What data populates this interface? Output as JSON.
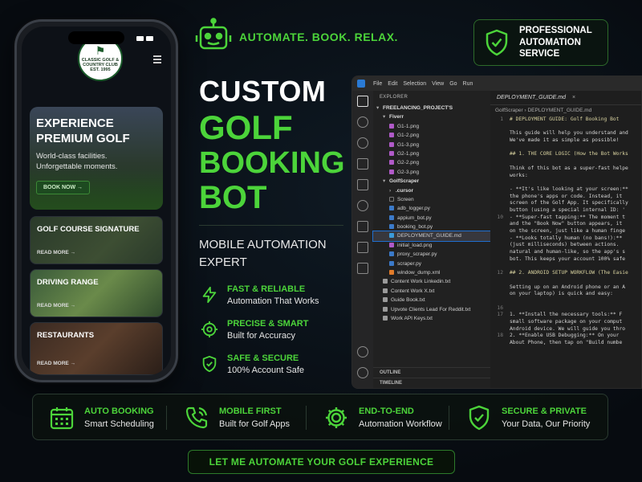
{
  "phone": {
    "status_time": "",
    "club_logo_text": "CLASSIC GOLF & COUNTRY CLUB",
    "club_logo_est": "EST. 1995",
    "hero_title_line1": "EXPERIENCE",
    "hero_title_line2": "PREMIUM GOLF",
    "hero_sub_line1": "World-class facilities.",
    "hero_sub_line2": "Unforgettable moments.",
    "book_button": "BOOK NOW →",
    "cards": [
      {
        "title": "GOLF COURSE SIGNATURE",
        "more": "READ MORE →"
      },
      {
        "title": "DRIVING RANGE",
        "more": "READ MORE →"
      },
      {
        "title": "RESTAURANTS",
        "more": "READ MORE →"
      }
    ]
  },
  "tagline": "AUTOMATE. BOOK. RELAX.",
  "headline": {
    "line1": "CUSTOM",
    "line2": "GOLF",
    "line3": "BOOKING",
    "line4": "BOT"
  },
  "subtitle": {
    "line1": "MOBILE AUTOMATION",
    "line2": "EXPERT"
  },
  "features": [
    {
      "title": "FAST & RELIABLE",
      "sub": "Automation That Works",
      "icon": "lightning-icon"
    },
    {
      "title": "PRECISE & SMART",
      "sub": "Built for Accuracy",
      "icon": "target-icon"
    },
    {
      "title": "SAFE & SECURE",
      "sub": "100% Account Safe",
      "icon": "shield-icon"
    }
  ],
  "pro_badge": {
    "line1": "PROFESSIONAL",
    "line2": "AUTOMATION",
    "line3": "SERVICE"
  },
  "vscode": {
    "menu": [
      "File",
      "Edit",
      "Selection",
      "View",
      "Go",
      "Run"
    ],
    "explorer_title": "EXPLORER",
    "project": "FREELANCING_PROJECT'S",
    "tree": [
      {
        "name": "Fiverr",
        "type": "folder",
        "depth": 1,
        "open": true
      },
      {
        "name": "G1-1.png",
        "type": "png",
        "depth": 2
      },
      {
        "name": "G1-2.png",
        "type": "png",
        "depth": 2
      },
      {
        "name": "G1-3.png",
        "type": "png",
        "depth": 2
      },
      {
        "name": "G2-1.png",
        "type": "png",
        "depth": 2
      },
      {
        "name": "G2-2.png",
        "type": "png",
        "depth": 2
      },
      {
        "name": "G2-3.png",
        "type": "png",
        "depth": 2
      },
      {
        "name": "GolfScraper",
        "type": "folder",
        "depth": 1,
        "open": true
      },
      {
        "name": ".cursor",
        "type": "folder",
        "depth": 2,
        "open": false
      },
      {
        "name": "Screen",
        "type": "none",
        "depth": 2
      },
      {
        "name": "adb_logger.py",
        "type": "py",
        "depth": 2
      },
      {
        "name": "appium_bot.py",
        "type": "py",
        "depth": 2
      },
      {
        "name": "booking_bot.py",
        "type": "py",
        "depth": 2
      },
      {
        "name": "DEPLOYMENT_GUIDE.md",
        "type": "md",
        "depth": 2,
        "selected": true
      },
      {
        "name": "initial_load.png",
        "type": "png",
        "depth": 2
      },
      {
        "name": "proxy_scraper.py",
        "type": "py",
        "depth": 2
      },
      {
        "name": "scraper.py",
        "type": "py",
        "depth": 2
      },
      {
        "name": "window_dump.xml",
        "type": "xml",
        "depth": 2
      },
      {
        "name": "Content Work Linkedin.txt",
        "type": "txt",
        "depth": 1
      },
      {
        "name": "Content Work X.txt",
        "type": "txt",
        "depth": 1
      },
      {
        "name": "Guide Book.txt",
        "type": "txt",
        "depth": 1
      },
      {
        "name": "Upvote Clients Lead For Reddit.txt",
        "type": "txt",
        "depth": 1
      },
      {
        "name": "Work API Keys.txt",
        "type": "txt",
        "depth": 1
      }
    ],
    "outline": "OUTLINE",
    "timeline": "TIMELINE",
    "tab": "DEPLOYMENT_GUIDE.md",
    "breadcrumb": "GolfScraper › DEPLOYMENT_GUIDE.md",
    "code": [
      {
        "n": "1",
        "t": "# DEPLOYMENT GUIDE: Golf Booking Bot",
        "h": true
      },
      {
        "n": "",
        "t": ""
      },
      {
        "n": "",
        "t": "This guide will help you understand and"
      },
      {
        "n": "",
        "t": "We've made it as simple as possible!"
      },
      {
        "n": "",
        "t": ""
      },
      {
        "n": "",
        "t": "## 1. THE CORE LOGIC (How the Bot Works",
        "h": true
      },
      {
        "n": "",
        "t": ""
      },
      {
        "n": "",
        "t": "Think of this bot as a super-fast helpe"
      },
      {
        "n": "",
        "t": "works:"
      },
      {
        "n": "",
        "t": ""
      },
      {
        "n": "",
        "t": "- **It's like looking at your screen:**"
      },
      {
        "n": "",
        "t": "the phone's apps or code. Instead, it"
      },
      {
        "n": "",
        "t": "screen of the Golf App. It specifically"
      },
      {
        "n": "",
        "t": "button (using a special internal ID: '"
      },
      {
        "n": "10",
        "t": "- **Super-fast tapping:** The moment t"
      },
      {
        "n": "",
        "t": "and the \"Book Now\" button appears, it"
      },
      {
        "n": "",
        "t": "on the screen, just like a human finge"
      },
      {
        "n": "",
        "t": "- **Looks totally human (no bans!):**"
      },
      {
        "n": "",
        "t": "(just milliseconds) between actions."
      },
      {
        "n": "",
        "t": "natural and human-like, so the app's s"
      },
      {
        "n": "",
        "t": "bot. This keeps your account 100% safe"
      },
      {
        "n": "",
        "t": ""
      },
      {
        "n": "12",
        "t": "## 2. ANDROID SETUP WORKFLOW (The Easie",
        "h": true
      },
      {
        "n": "",
        "t": ""
      },
      {
        "n": "",
        "t": "Setting up on an Android phone or an A"
      },
      {
        "n": "",
        "t": "on your laptop) is quick and easy:"
      },
      {
        "n": "",
        "t": ""
      },
      {
        "n": "16",
        "t": ""
      },
      {
        "n": "17",
        "t": "1. **Install the necessary tools:** F"
      },
      {
        "n": "",
        "t": "small software package on your comput"
      },
      {
        "n": "",
        "t": "Android device. We will guide you thro"
      },
      {
        "n": "18",
        "t": "2. **Enable USB Debugging:** On your"
      },
      {
        "n": "",
        "t": "About Phone, then tap on \"Build numbe"
      }
    ]
  },
  "bottom_features": [
    {
      "title": "AUTO BOOKING",
      "sub": "Smart Scheduling",
      "icon": "calendar-icon"
    },
    {
      "title": "MOBILE FIRST",
      "sub": "Built for Golf Apps",
      "icon": "phone-icon"
    },
    {
      "title": "END-TO-END",
      "sub": "Automation Workflow",
      "icon": "gear-icon"
    },
    {
      "title": "SECURE & PRIVATE",
      "sub": "Your Data, Our Priority",
      "icon": "shield-check-icon"
    }
  ],
  "cta": "LET ME AUTOMATE YOUR GOLF EXPERIENCE",
  "colors": {
    "accent": "#4cd43a",
    "background": "#070b10"
  }
}
